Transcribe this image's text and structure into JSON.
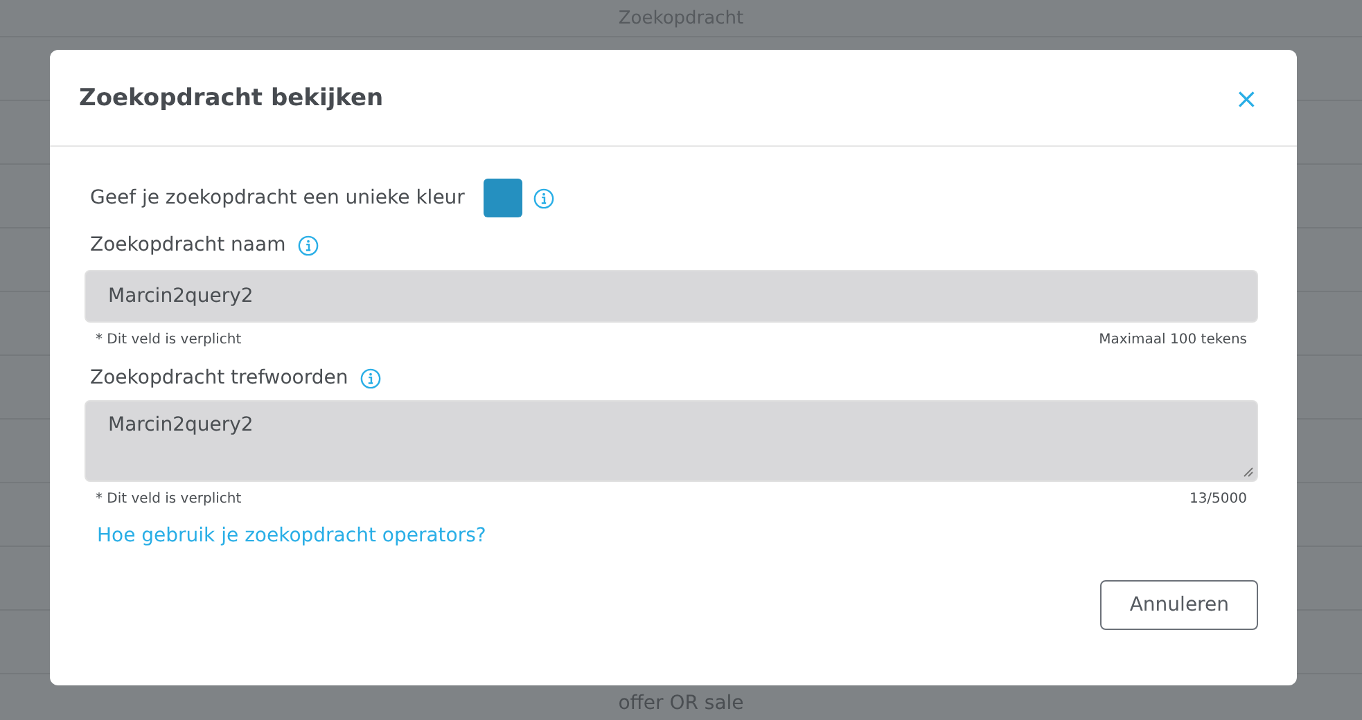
{
  "background": {
    "column_header": "Zoekopdracht",
    "last_row": "offer OR sale"
  },
  "dialog": {
    "title": "Zoekopdracht bekijken",
    "close": "×",
    "color_label": "Geef je zoekopdracht een unieke kleur",
    "color": "#2590c0",
    "name_field": {
      "label": "Zoekopdracht naam",
      "value": "Marcin2query2",
      "required_note": "* Dit veld is verplicht",
      "limit_note": "Maximaal 100 tekens",
      "disabled": true
    },
    "keywords_field": {
      "label": "Zoekopdracht trefwoorden",
      "value": "Marcin2query2",
      "required_note": "* Dit veld is verplicht",
      "limit_note": "13/5000",
      "disabled": true
    },
    "help_link": "Hoe gebruik je zoekopdracht operators?",
    "buttons": [
      "Annuleren"
    ]
  }
}
